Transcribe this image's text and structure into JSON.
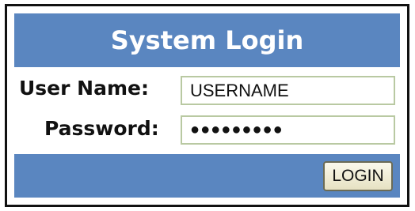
{
  "login": {
    "title": "System Login",
    "username_label": "User Name:",
    "username_value": "USERNAME",
    "password_label": "Password:",
    "password_display": "●●●●●●●●●",
    "login_label": "LOGIN"
  },
  "colors": {
    "panel_blue": "#5a86c0",
    "field_border": "#b9c9a2",
    "button_face": "#f1eed8"
  }
}
